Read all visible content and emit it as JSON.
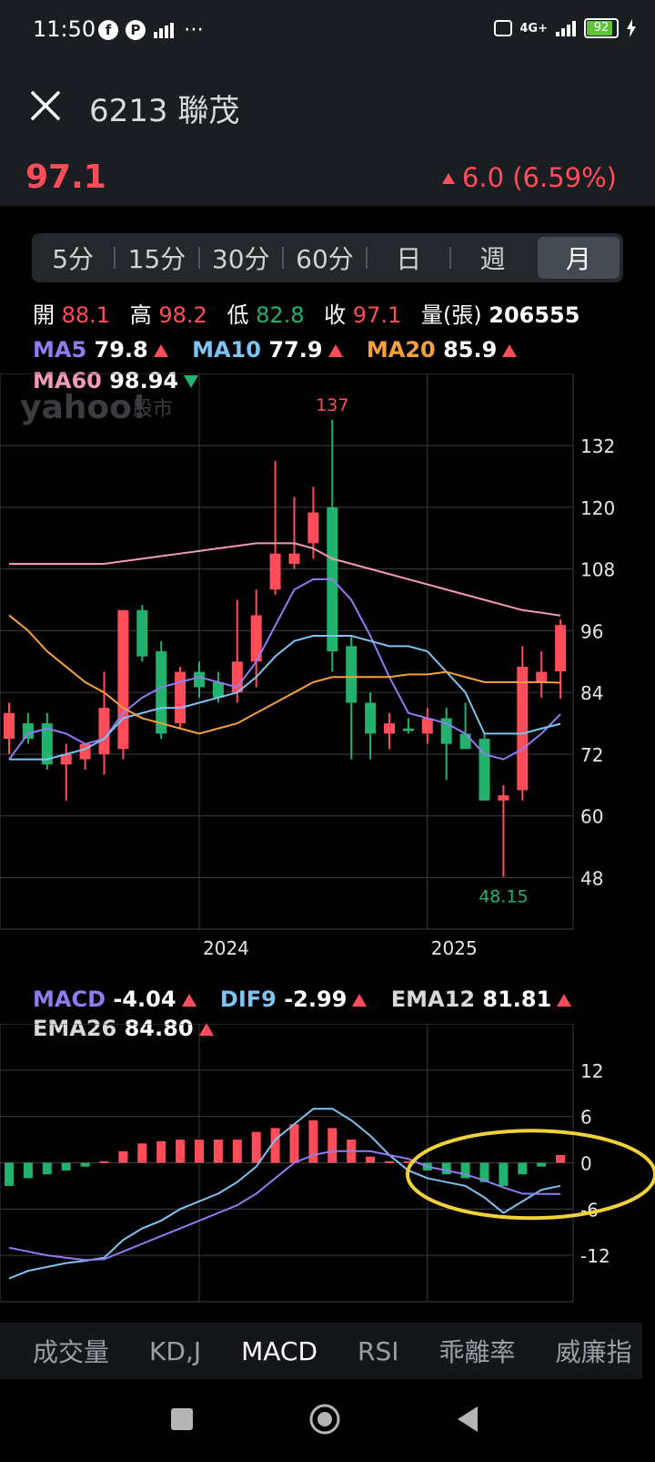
{
  "status_bar": {
    "time": "11:50",
    "battery": "92",
    "network": "4G+"
  },
  "header": {
    "title": "6213 聯茂",
    "price": "97.1",
    "change": "6.0 (6.59%)"
  },
  "period_tabs": [
    "5分",
    "15分",
    "30分",
    "60分",
    "日",
    "週",
    "月"
  ],
  "active_period": "月",
  "ohlc": {
    "open_label": "開",
    "open": "88.1",
    "high_label": "高",
    "high": "98.2",
    "low_label": "低",
    "low": "82.8",
    "close_label": "收",
    "close": "97.1",
    "volume_label": "量(張)",
    "volume": "206555"
  },
  "ma": {
    "ma5_label": "MA5",
    "ma5": "79.8",
    "ma10_label": "MA10",
    "ma10": "77.9",
    "ma20_label": "MA20",
    "ma20": "85.9",
    "ma60_label": "MA60",
    "ma60": "98.94"
  },
  "macd_legend": {
    "macd_label": "MACD",
    "macd": "-4.04",
    "dif_label": "DIF9",
    "dif": "-2.99",
    "ema12_label": "EMA12",
    "ema12": "81.81",
    "ema26_label": "EMA26",
    "ema26": "84.80"
  },
  "watermark": {
    "brand": "yahoo!",
    "suffix": "股市"
  },
  "indicator_tabs": [
    "成交量",
    "KD,J",
    "MACD",
    "RSI",
    "乖離率",
    "威廉指"
  ],
  "active_indicator": "MACD",
  "colors": {
    "up": "#ff4d5a",
    "down": "#23b26d",
    "ma5": "#8f7cf0",
    "ma10": "#7ec3f2",
    "ma20": "#f6a13b",
    "ma60": "#f59bb8",
    "highlight": "#f1d23a"
  },
  "chart_data": [
    {
      "type": "candlestick",
      "ylim": [
        38,
        146
      ],
      "yticks": [
        132,
        120,
        108,
        96,
        84,
        72,
        60,
        48
      ],
      "xticks": [
        {
          "index": 10,
          "label": "2024"
        },
        {
          "index": 22,
          "label": "2025"
        }
      ],
      "annotations": {
        "high": "137",
        "low": "48.15"
      },
      "candles": [
        {
          "o": 75,
          "h": 82,
          "l": 72,
          "c": 80
        },
        {
          "o": 78,
          "h": 80,
          "l": 74,
          "c": 75
        },
        {
          "o": 78,
          "h": 80,
          "l": 69,
          "c": 70
        },
        {
          "o": 70,
          "h": 74,
          "l": 63,
          "c": 72
        },
        {
          "o": 71,
          "h": 74,
          "l": 69,
          "c": 74
        },
        {
          "o": 72,
          "h": 88,
          "l": 68,
          "c": 81
        },
        {
          "o": 73,
          "h": 99,
          "l": 71,
          "c": 100
        },
        {
          "o": 100,
          "h": 101,
          "l": 90,
          "c": 91
        },
        {
          "o": 92,
          "h": 94,
          "l": 75,
          "c": 76
        },
        {
          "o": 78,
          "h": 89,
          "l": 77,
          "c": 88
        },
        {
          "o": 88,
          "h": 90,
          "l": 83,
          "c": 85
        },
        {
          "o": 86,
          "h": 88,
          "l": 82,
          "c": 83
        },
        {
          "o": 84,
          "h": 102,
          "l": 82,
          "c": 90
        },
        {
          "o": 90,
          "h": 104,
          "l": 85,
          "c": 99
        },
        {
          "o": 104,
          "h": 129,
          "l": 103,
          "c": 111
        },
        {
          "o": 109,
          "h": 122,
          "l": 108,
          "c": 111
        },
        {
          "o": 113,
          "h": 124,
          "l": 110,
          "c": 119
        },
        {
          "o": 120,
          "h": 137,
          "l": 88,
          "c": 92
        },
        {
          "o": 93,
          "h": 95,
          "l": 71,
          "c": 82
        },
        {
          "o": 82,
          "h": 84,
          "l": 71,
          "c": 76
        },
        {
          "o": 76,
          "h": 80,
          "l": 73,
          "c": 78
        },
        {
          "o": 77,
          "h": 79,
          "l": 76,
          "c": 76.5
        },
        {
          "o": 76,
          "h": 81,
          "l": 74,
          "c": 79
        },
        {
          "o": 79,
          "h": 81,
          "l": 67,
          "c": 74
        },
        {
          "o": 76,
          "h": 82,
          "l": 73,
          "c": 73
        },
        {
          "o": 75,
          "h": 76,
          "l": 63,
          "c": 63
        },
        {
          "o": 63,
          "h": 66,
          "l": 48.15,
          "c": 64
        },
        {
          "o": 65,
          "h": 93,
          "l": 63,
          "c": 89
        },
        {
          "o": 86,
          "h": 92,
          "l": 83,
          "c": 88
        },
        {
          "o": 88.1,
          "h": 98.2,
          "l": 82.8,
          "c": 97.1
        }
      ],
      "series": [
        {
          "name": "MA5",
          "values": [
            71,
            76,
            77,
            76,
            74,
            75,
            80,
            83,
            85,
            86,
            87,
            86,
            85,
            90,
            97,
            104,
            106,
            106,
            102,
            95,
            87,
            80,
            79,
            78,
            76,
            72,
            71,
            73,
            76,
            79.8
          ]
        },
        {
          "name": "MA10",
          "values": [
            71,
            71,
            71,
            72,
            73,
            75,
            79,
            80,
            81,
            81,
            82,
            83,
            84,
            87,
            91,
            94,
            95,
            95,
            95,
            94,
            93,
            93,
            92,
            88,
            84,
            76,
            76,
            76,
            77,
            77.9
          ]
        },
        {
          "name": "MA20",
          "values": [
            99,
            96,
            92,
            89,
            86,
            84,
            81,
            79,
            78,
            77,
            76,
            77,
            78,
            80,
            82,
            84,
            86,
            87,
            87,
            87,
            87,
            87.5,
            87.5,
            88,
            87,
            86,
            86,
            86,
            86,
            85.9
          ]
        },
        {
          "name": "MA60",
          "values": [
            109,
            109,
            109,
            109,
            109,
            109,
            109.5,
            110,
            110.5,
            111,
            111.5,
            112,
            112.5,
            113,
            113,
            113,
            112,
            110,
            109,
            108,
            107,
            106,
            105,
            104,
            103,
            102,
            101,
            100,
            99.5,
            98.94
          ]
        }
      ]
    },
    {
      "type": "bar",
      "ylim": [
        -18,
        18
      ],
      "yticks": [
        12,
        6,
        0,
        -6,
        -12
      ],
      "highlight": "ellipse around latest bars",
      "series": [
        {
          "name": "MACD",
          "values": [
            -3,
            -2,
            -1.5,
            -1,
            -0.5,
            0.2,
            1.5,
            2.5,
            2.8,
            3,
            3,
            3,
            3,
            4,
            4.5,
            5,
            5.5,
            4.5,
            3,
            0.8,
            0.2,
            0.2,
            -1,
            -1.5,
            -2,
            -2.5,
            -3,
            -1.5,
            -0.5,
            1
          ]
        },
        {
          "name": "DIF9",
          "values": [
            -15,
            -14,
            -13.5,
            -13,
            -12.7,
            -12.3,
            -10,
            -8.5,
            -7.5,
            -6,
            -5,
            -4,
            -2.5,
            -0.5,
            3,
            5,
            7,
            7,
            5.5,
            3.5,
            1,
            -1,
            -2,
            -2.5,
            -3,
            -4.5,
            -6.5,
            -5,
            -3.5,
            -2.99
          ]
        },
        {
          "name": "EMA12",
          "values": [
            -11,
            -11.5,
            -12,
            -12.3,
            -12.6,
            -12.5,
            -11.5,
            -10.5,
            -9.5,
            -8.5,
            -7.5,
            -6.5,
            -5.5,
            -4,
            -2,
            0,
            1,
            1.5,
            1.5,
            1.5,
            1,
            0.5,
            -0.5,
            -1,
            -1.5,
            -2.3,
            -3.2,
            -4,
            -4.04,
            -4.04
          ]
        }
      ]
    }
  ]
}
